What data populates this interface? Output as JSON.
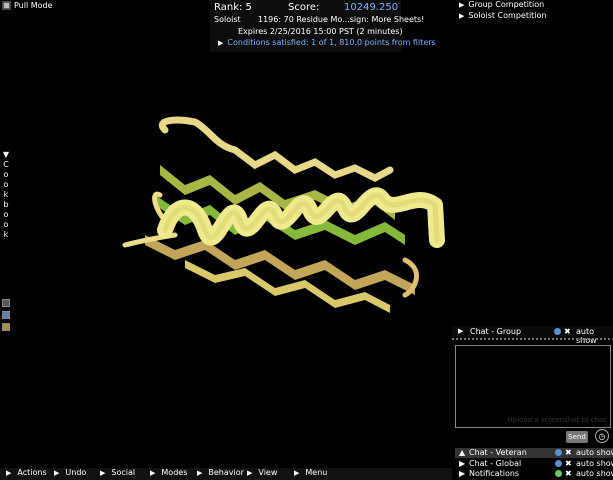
{
  "top_left": {
    "mode_label": "Pull Mode"
  },
  "score_panel": {
    "rank_label": "Rank: 5",
    "score_label": "Score:",
    "score_value": "10249.250",
    "mode": "Soloist",
    "puzzle": "1196: 70 Residue Mo...sign: More Sheets!",
    "expires": "Expires 2/25/2016 15:00 PST (2 minutes)",
    "conditions": "Conditions satisfied: 1 of 1, 810.0 points from filters",
    "score_color": "#79b2ff"
  },
  "competitions": [
    {
      "label": "Group Competition"
    },
    {
      "label": "Soloist Competition"
    }
  ],
  "cookbook": {
    "letters": [
      "C",
      "o",
      "o",
      "k",
      "b",
      "o",
      "o",
      "k"
    ]
  },
  "bottom_menu": [
    {
      "label": "Actions"
    },
    {
      "label": "Undo"
    },
    {
      "label": "Social"
    },
    {
      "label": "Modes"
    },
    {
      "label": "Behavior"
    },
    {
      "label": "View"
    },
    {
      "label": "Menu"
    }
  ],
  "chat": {
    "header_label": "Chat - Group",
    "auto_show": "auto show",
    "placeholder": "Upload a screenshot to chat",
    "send_label": "Send",
    "channels": [
      {
        "label": "Chat - Veteran",
        "auto_show": "auto show"
      },
      {
        "label": "Chat - Global",
        "auto_show": "auto show"
      },
      {
        "label": "Notifications",
        "auto_show": "auto show"
      }
    ]
  },
  "icons": [
    "pull-mode-icon",
    "triangle-right-icon",
    "triangle-down-icon",
    "info-icon",
    "close-icon",
    "clock-icon"
  ],
  "colors": {
    "sheet_yellow": "#d9c96a",
    "sheet_green": "#86b83a",
    "helix": "#ecec8a",
    "loop": "#f0e08a"
  }
}
